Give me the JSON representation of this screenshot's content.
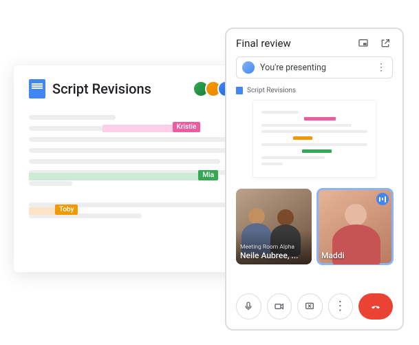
{
  "docs": {
    "title": "Script Revisions",
    "avatar_more_glyph": "+",
    "collaborators": [
      {
        "name": "Kristie",
        "color": "#ee5b9f"
      },
      {
        "name": "Mia",
        "color": "#34a853"
      },
      {
        "name": "Toby",
        "color": "#f29900"
      }
    ]
  },
  "meet": {
    "title": "Final review",
    "presenting_text": "You're presenting",
    "preview_doc_title": "Script Revisions",
    "tiles": [
      {
        "room": "Meeting Room Alpha",
        "names": "Neile Aubree, ..."
      },
      {
        "names": "Maddi"
      }
    ]
  }
}
